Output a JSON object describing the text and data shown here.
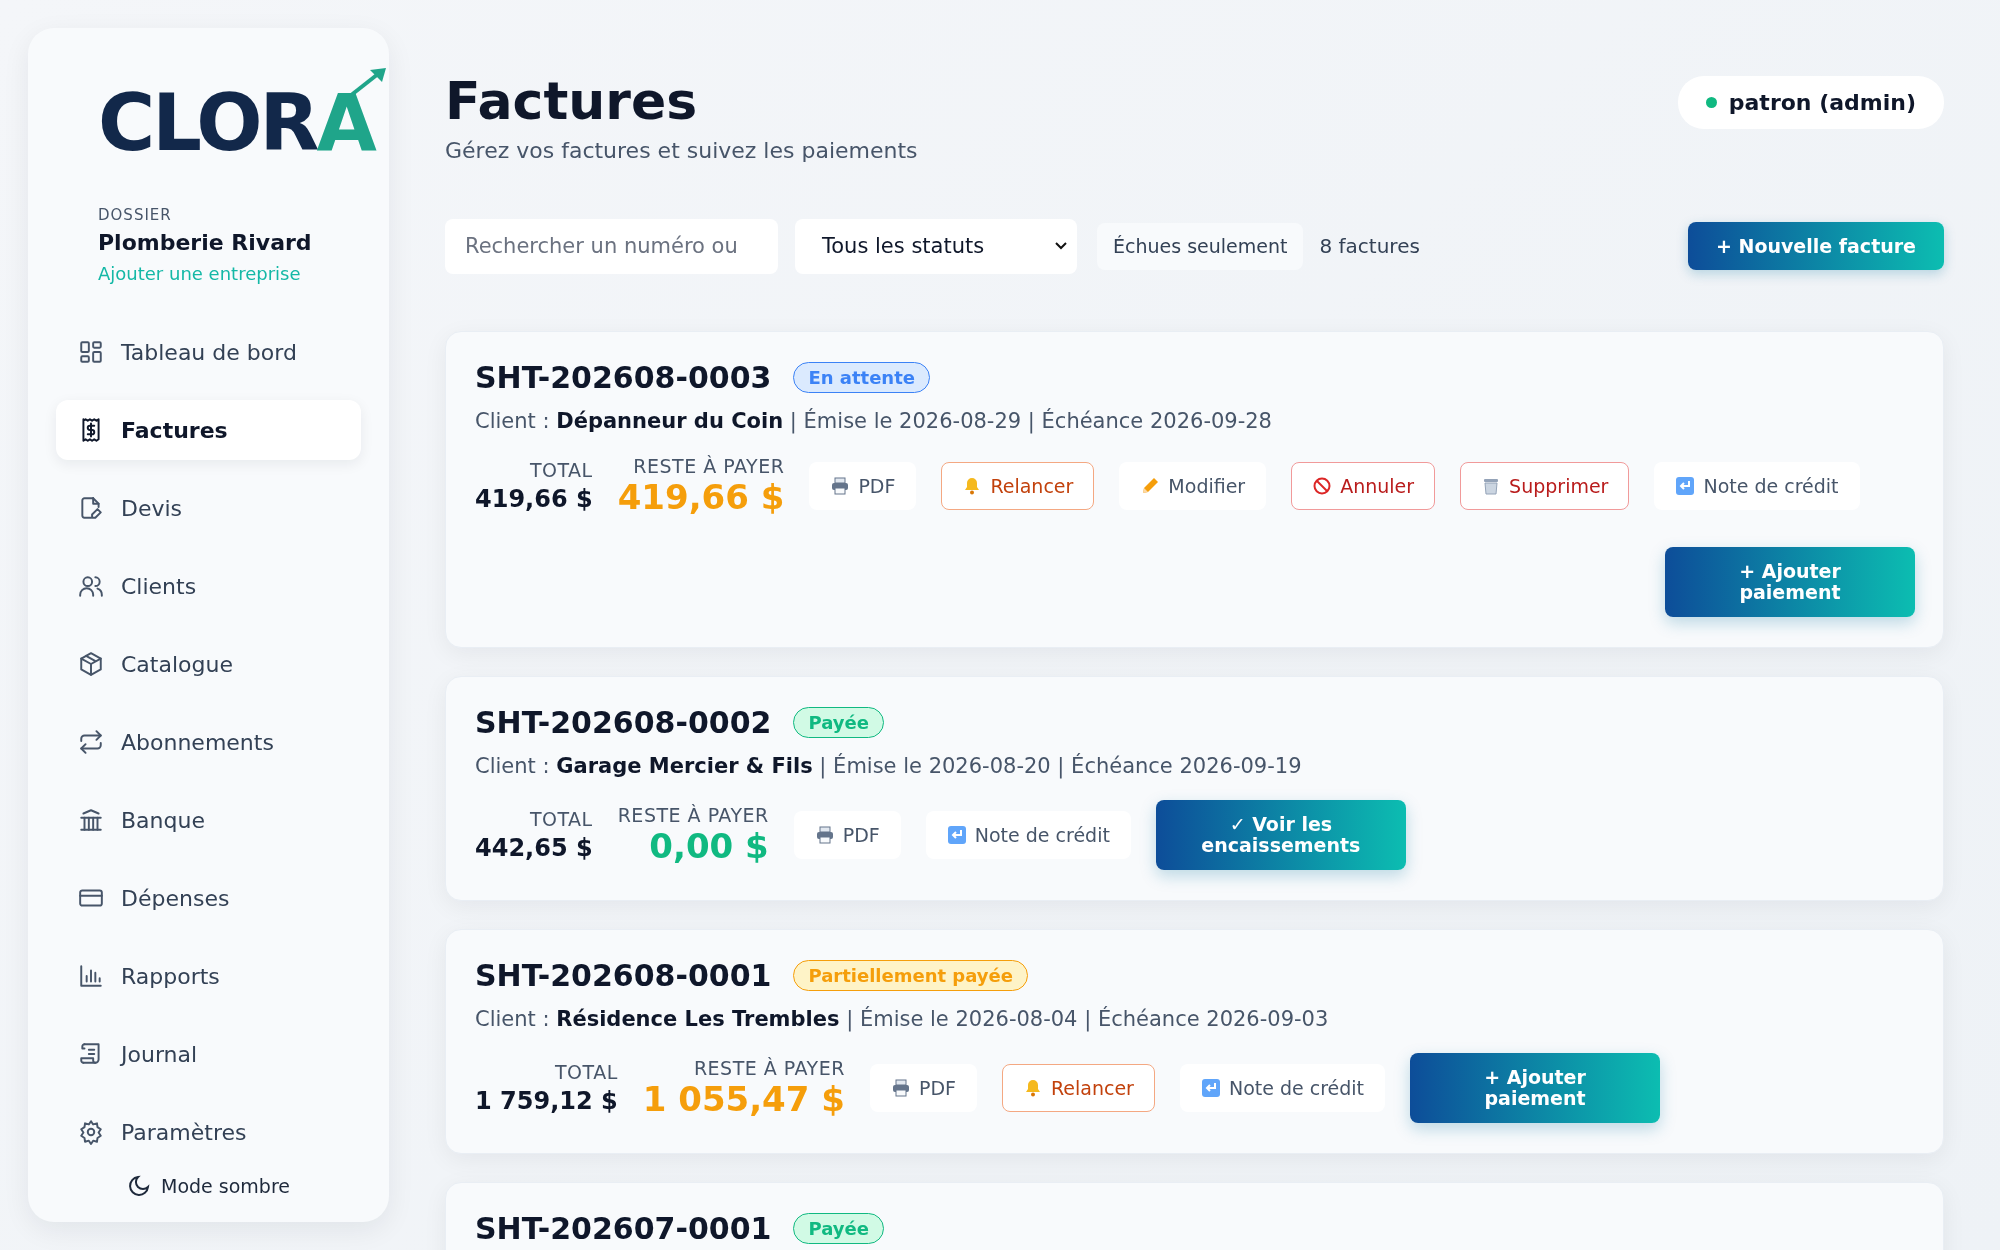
{
  "logo": {
    "main": "CLOR",
    "accent": "A"
  },
  "dossier": {
    "label": "DOSSIER",
    "name": "Plomberie Rivard",
    "link": "Ajouter une entreprise"
  },
  "nav": [
    {
      "label": "Tableau de bord",
      "selected": false
    },
    {
      "label": "Factures",
      "selected": true
    },
    {
      "label": "Devis",
      "selected": false
    },
    {
      "label": "Clients",
      "selected": false
    },
    {
      "label": "Catalogue",
      "selected": false
    },
    {
      "label": "Abonnements",
      "selected": false
    },
    {
      "label": "Banque",
      "selected": false
    },
    {
      "label": "Dépenses",
      "selected": false
    },
    {
      "label": "Rapports",
      "selected": false
    },
    {
      "label": "Journal",
      "selected": false
    },
    {
      "label": "Paramètres",
      "selected": false
    }
  ],
  "dark_mode": {
    "label": "Mode sombre"
  },
  "header": {
    "title": "Factures",
    "subtitle": "Gérez vos factures et suivez les paiements"
  },
  "user": {
    "label": "patron (admin)",
    "color": "#10b981"
  },
  "filters": {
    "search": {
      "placeholder": "Rechercher un numéro ou"
    },
    "status_select": "Tous les statuts",
    "overdue_toggle": "Échues seulement",
    "count": "8 factures",
    "new_button": "+ Nouvelle facture"
  },
  "invoices": [
    {
      "number": "SHT-202608-0003",
      "kind": "pending",
      "badge": "En attente",
      "details": "Client : **Dépanneur du Coin** | Émise le 2026-08-29 | Échéance 2026-09-28",
      "total_label": "TOTAL",
      "total": "419,66 $",
      "due_label": "RESTE À PAYER",
      "due": "419,66 $",
      "actions": [
        {
          "kind": "pdf",
          "label": "PDF"
        },
        {
          "kind": "remind",
          "label": "Relancer"
        },
        {
          "kind": "edit",
          "label": "Modifier"
        },
        {
          "kind": "cancel",
          "label": "Annuler"
        },
        {
          "kind": "delete",
          "label": "Supprimer"
        },
        {
          "kind": "credit",
          "label": "Note de crédit"
        },
        {
          "kind": "primary",
          "label": "+ Ajouter paiement"
        }
      ]
    },
    {
      "number": "SHT-202608-0002",
      "kind": "paid",
      "badge": "Payée",
      "details": "Client : **Garage Mercier & Fils** | Émise le 2026-08-20 | Échéance 2026-09-19",
      "total_label": "TOTAL",
      "total": "442,65 $",
      "due_label": "RESTE À PAYER",
      "due": "0,00 $",
      "actions": [
        {
          "kind": "pdf",
          "label": "PDF"
        },
        {
          "kind": "credit",
          "label": "Note de crédit"
        },
        {
          "kind": "primary",
          "label": "✓ Voir les encaissements"
        }
      ]
    },
    {
      "number": "SHT-202608-0001",
      "kind": "partial",
      "badge": "Partiellement payée",
      "details": "Client : **Résidence Les Trembles** | Émise le 2026-08-04 | Échéance 2026-09-03",
      "total_label": "TOTAL",
      "total": "1 759,12 $",
      "due_label": "RESTE À PAYER",
      "due": "1 055,47 $",
      "actions": [
        {
          "kind": "pdf",
          "label": "PDF"
        },
        {
          "kind": "remind",
          "label": "Relancer"
        },
        {
          "kind": "credit",
          "label": "Note de crédit"
        },
        {
          "kind": "primary",
          "label": "+ Ajouter paiement"
        }
      ]
    },
    {
      "number": "SHT-202607-0001",
      "kind": "paid",
      "badge": "Payée"
    }
  ]
}
